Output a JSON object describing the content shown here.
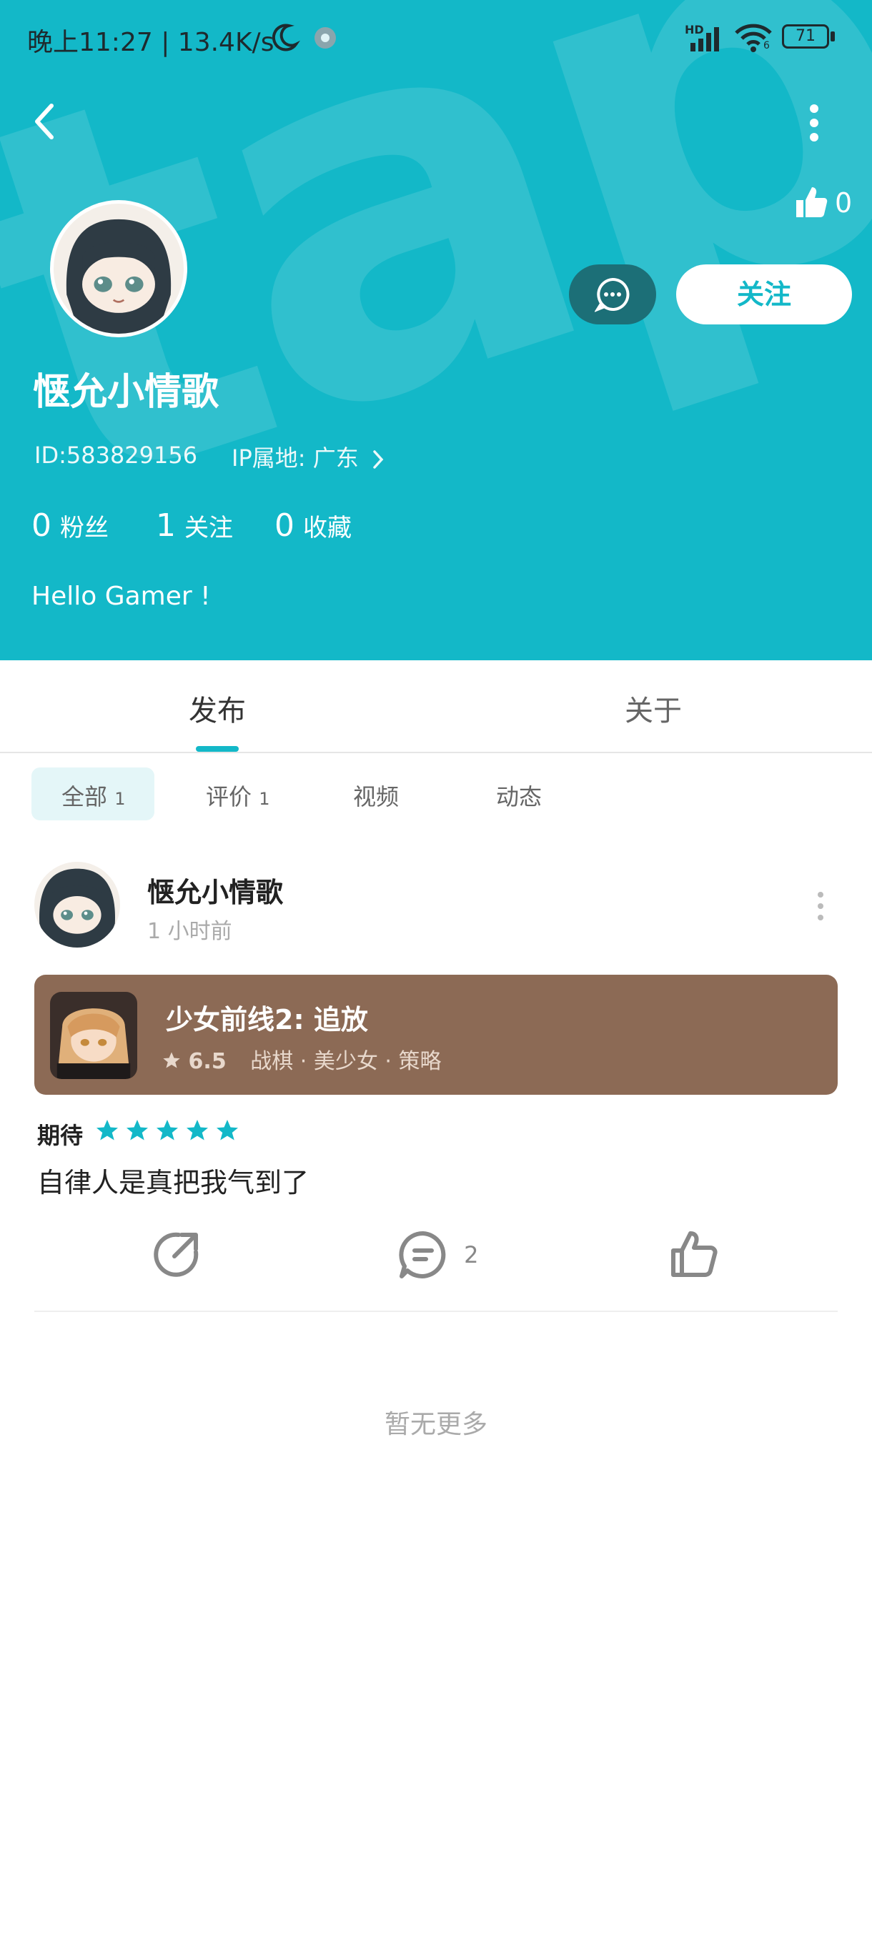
{
  "status_bar": {
    "time": "晚上11:27",
    "separator": "|",
    "speed": "13.4K/s",
    "network": "HD",
    "wifi_sub": "6",
    "battery": "71"
  },
  "header": {
    "likes": "0",
    "follow_label": "关注",
    "username": "惬允小情歌",
    "id_text": "ID:583829156",
    "ip_text": "IP属地: 广东",
    "stats": [
      {
        "count": "0",
        "label": "粉丝"
      },
      {
        "count": "1",
        "label": "关注"
      },
      {
        "count": "0",
        "label": "收藏"
      }
    ],
    "bio": "Hello Gamer !",
    "watermark": "tapTap",
    "bg_color": "#13b8c8"
  },
  "tabs": [
    {
      "label": "发布"
    },
    {
      "label": "关于"
    }
  ],
  "subtabs": [
    {
      "label": "全部",
      "count": "1"
    },
    {
      "label": "评价",
      "count": "1"
    },
    {
      "label": "视频",
      "count": ""
    },
    {
      "label": "动态",
      "count": ""
    }
  ],
  "post": {
    "author": "惬允小情歌",
    "time": "1 小时前",
    "game": {
      "title": "少女前线2: 追放",
      "rating": "6.5",
      "tags": "战棋 · 美少女 · 策略",
      "card_color": "#8c6a55"
    },
    "rating_label": "期待",
    "stars": 5,
    "content": "自律人是真把我气到了",
    "comments": "2"
  },
  "footer_text": "暂无更多"
}
